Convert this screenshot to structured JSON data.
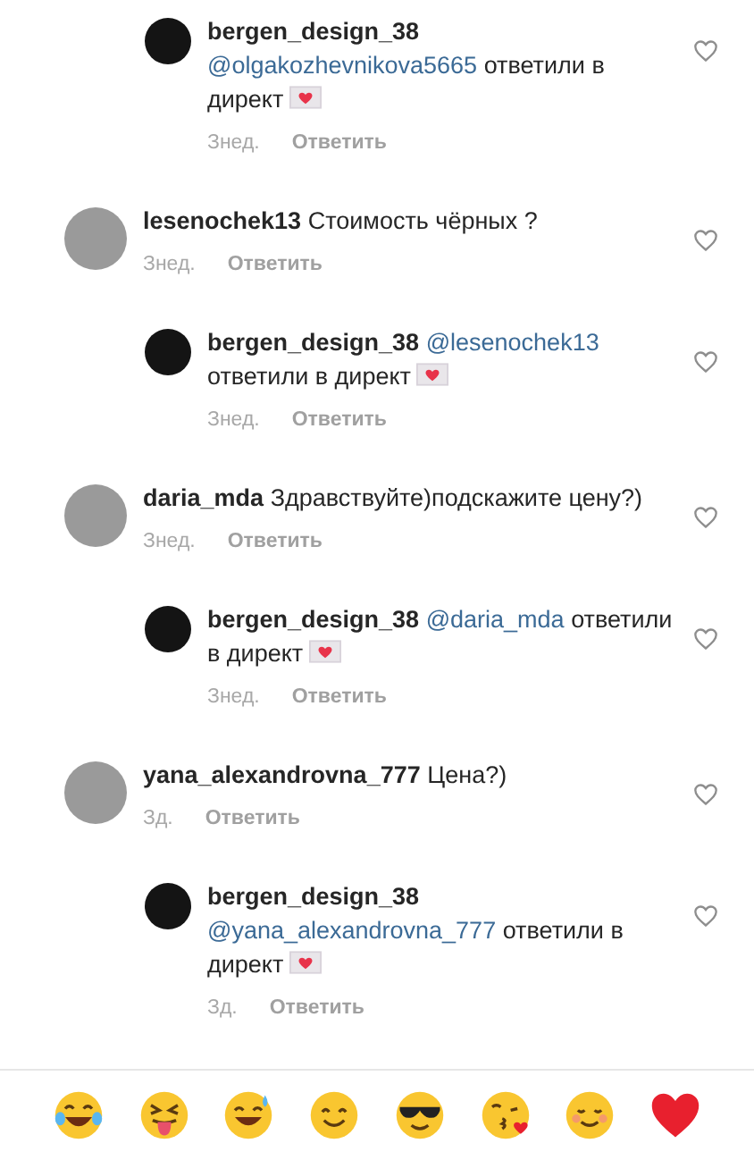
{
  "comments": [
    {
      "kind": "reply",
      "user": "bergen_design_38",
      "mention": "@olgakozhevnikova5665",
      "text": "ответили в директ",
      "love_letter": true,
      "time": "Знед.",
      "reply_label": "Ответить",
      "liked": false
    },
    {
      "kind": "comment",
      "user": "lesenochek13",
      "text": "Стоимость чёрных ?",
      "time": "Знед.",
      "reply_label": "Ответить",
      "liked": false
    },
    {
      "kind": "reply",
      "user": "bergen_design_38",
      "mention": "@lesenochek13",
      "text": "ответили в директ",
      "love_letter": true,
      "time": "Знед.",
      "reply_label": "Ответить",
      "liked": false
    },
    {
      "kind": "comment",
      "user": "daria_mda",
      "text": "Здравствуйте)подскажите цену?)",
      "time": "Знед.",
      "reply_label": "Ответить",
      "liked": false
    },
    {
      "kind": "reply",
      "user": "bergen_design_38",
      "mention": "@daria_mda",
      "text": "ответили в директ",
      "love_letter": true,
      "time": "Знед.",
      "reply_label": "Ответить",
      "liked": false
    },
    {
      "kind": "comment",
      "user": "yana_alexandrovna_777",
      "text": "Цена?)",
      "time": "Зд.",
      "reply_label": "Ответить",
      "liked": false
    },
    {
      "kind": "reply",
      "user": "bergen_design_38",
      "mention": "@yana_alexandrovna_777",
      "text": "ответили в директ",
      "love_letter": true,
      "time": "Зд.",
      "reply_label": "Ответить",
      "liked": false
    }
  ]
}
